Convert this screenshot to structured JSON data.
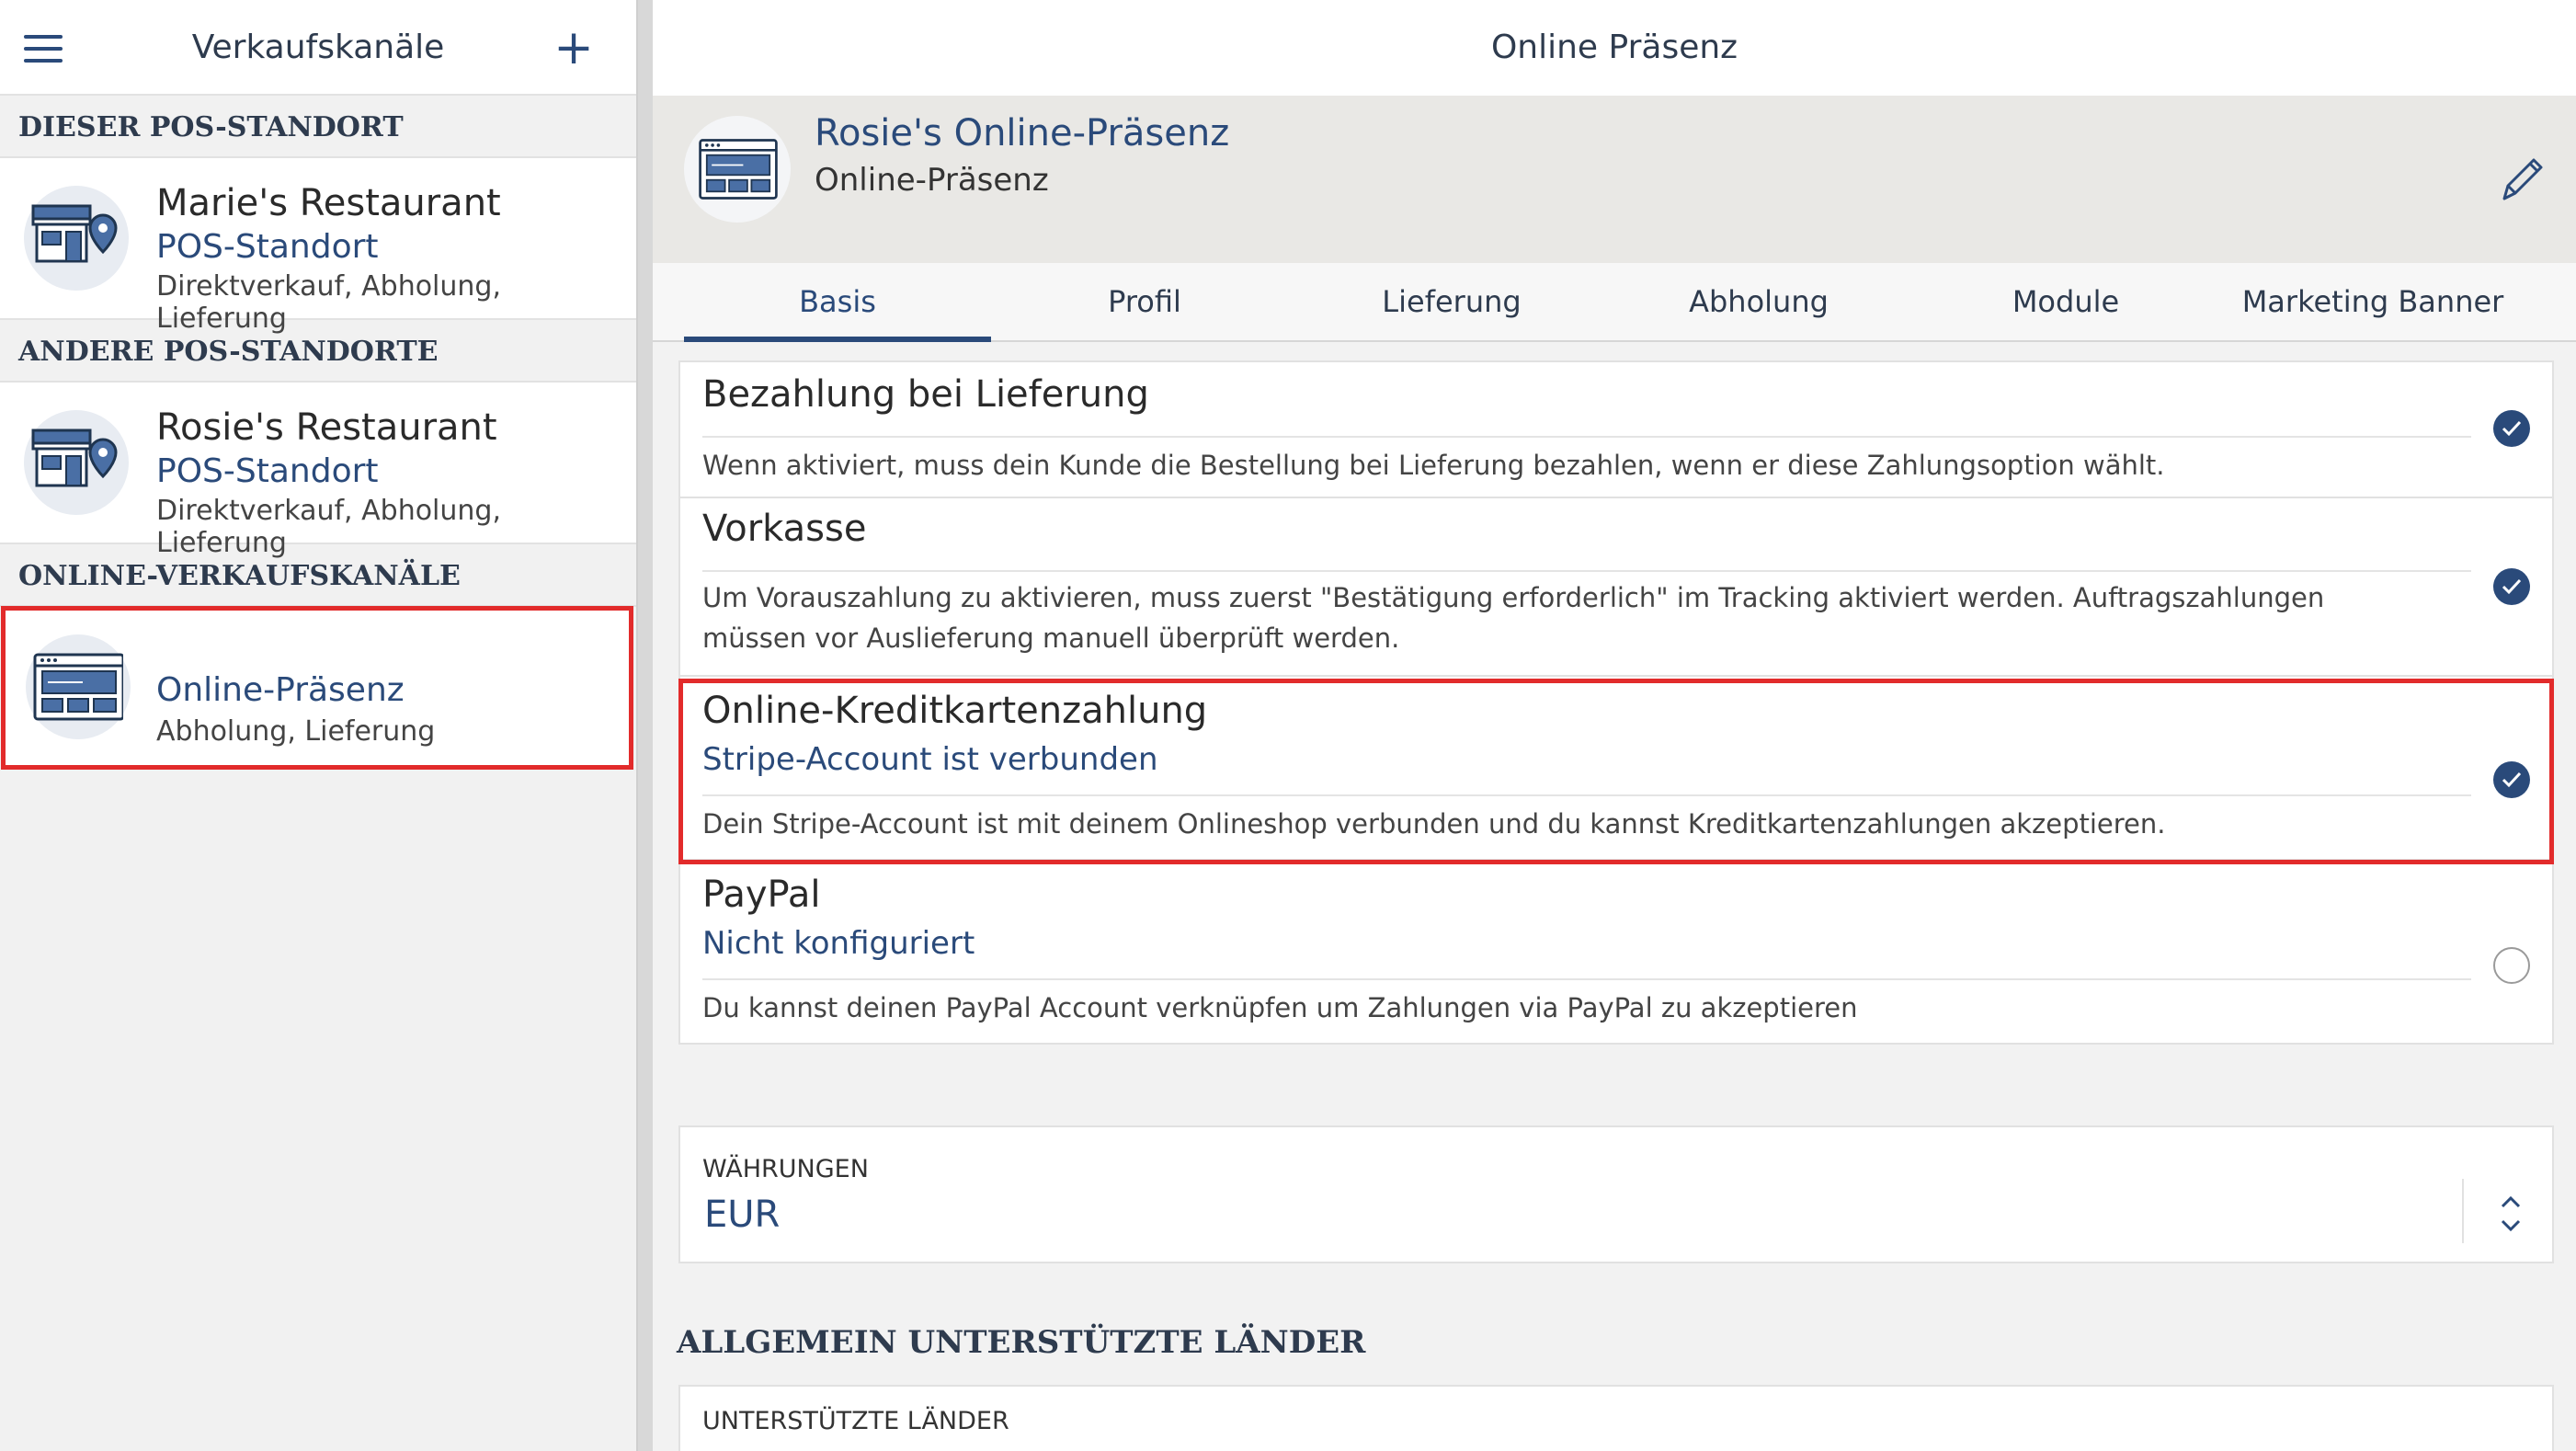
{
  "sidebar": {
    "title": "Verkaufskanäle",
    "sections": [
      {
        "label": "DIESER POS-STANDORT"
      },
      {
        "label": "ANDERE POS-STANDORTE"
      },
      {
        "label": "ONLINE-VERKAUFSKANÄLE"
      }
    ],
    "items": [
      {
        "name": "Marie's Restaurant",
        "type": "POS-Standort",
        "channels": "Direktverkauf, Abholung, Lieferung",
        "icon": "store-location-icon"
      },
      {
        "name": "Rosie's Restaurant",
        "type": "POS-Standort",
        "channels": "Direktverkauf, Abholung, Lieferung",
        "icon": "store-location-icon"
      },
      {
        "name": "Online-Präsenz",
        "channels": "Abholung, Lieferung",
        "icon": "browser-window-icon",
        "selected": true
      }
    ]
  },
  "main": {
    "header_title": "Online Präsenz",
    "profile": {
      "name": "Rosie's Online-Präsenz",
      "subtitle": "Online-Präsenz",
      "edit_icon": "pencil-icon"
    },
    "tabs": [
      {
        "label": "Basis",
        "active": true
      },
      {
        "label": "Profil"
      },
      {
        "label": "Lieferung"
      },
      {
        "label": "Abholung"
      },
      {
        "label": "Module"
      },
      {
        "label": "Marketing Banner"
      }
    ],
    "payments": [
      {
        "title": "Bezahlung bei Lieferung",
        "description": "Wenn aktiviert, muss dein Kunde die Bestellung bei Lieferung bezahlen, wenn er diese Zahlungsoption wählt.",
        "enabled": true
      },
      {
        "title": "Vorkasse",
        "description": "Um Vorauszahlung zu aktivieren, muss zuerst \"Bestätigung erforderlich\" im Tracking aktiviert werden. Auftragszahlungen müssen vor Auslieferung manuell überprüft werden.",
        "enabled": true
      },
      {
        "title": "Online-Kreditkartenzahlung",
        "status": "Stripe-Account ist verbunden",
        "description": "Dein Stripe-Account ist mit deinem Onlineshop verbunden und du kannst Kreditkartenzahlungen akzeptieren.",
        "enabled": true,
        "highlighted": true
      },
      {
        "title": "PayPal",
        "status": "Nicht konfiguriert",
        "description": "Du kannst deinen PayPal Account verknüpfen um Zahlungen via PayPal zu akzeptieren",
        "enabled": false
      }
    ],
    "currency": {
      "label": "WÄHRUNGEN",
      "value": "EUR"
    },
    "countries": {
      "heading": "ALLGEMEIN UNTERSTÜTZTE LÄNDER",
      "label": "UNTERSTÜTZTE LÄNDER"
    }
  },
  "colors": {
    "accent": "#2a4a7a",
    "highlight": "#e22b2b",
    "background": "#f2f2f2"
  }
}
